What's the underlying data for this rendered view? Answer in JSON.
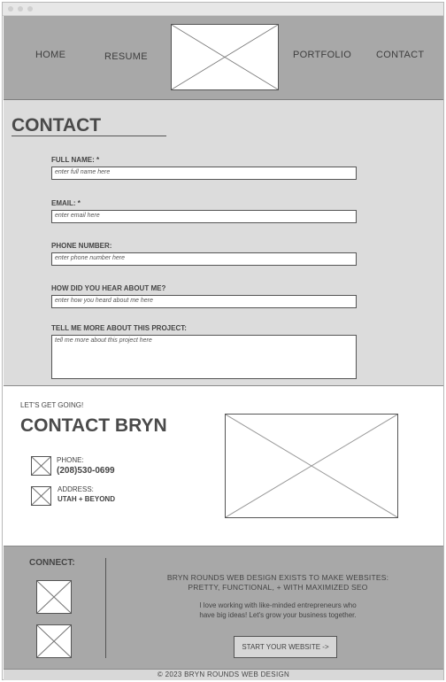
{
  "nav": {
    "home": "HOME",
    "resume": "RESUME",
    "portfolio": "PORTFOLIO",
    "contact": "CONTACT"
  },
  "contact_form": {
    "title": "CONTACT",
    "fields": [
      {
        "label": "FULL NAME: *",
        "placeholder": "enter full name here"
      },
      {
        "label": "EMAIL: *",
        "placeholder": "enter email here"
      },
      {
        "label": "PHONE NUMBER:",
        "placeholder": "enter phone number here"
      },
      {
        "label": "HOW DID YOU HEAR ABOUT ME?",
        "placeholder": "enter how you heard about me here"
      },
      {
        "label": "TELL ME MORE ABOUT THIS PROJECT:",
        "placeholder": "tell me more about this project here"
      }
    ]
  },
  "info": {
    "eyebrow": "LET'S GET GOING!",
    "title": "CONTACT BRYN",
    "phone_label": "PHONE:",
    "phone_value": "(208)530-0699",
    "address_label": "ADDRESS:",
    "address_value": "UTAH + BEYOND"
  },
  "footer": {
    "connect": "CONNECT:",
    "tagline_1": "BRYN ROUNDS WEB DESIGN EXISTS TO MAKE WEBSITES:",
    "tagline_2": "PRETTY, FUNCTIONAL, + WITH MAXIMIZED SEO",
    "blurb_1": "I love working with like-minded entrepreneurs who",
    "blurb_2": "have big ideas! Let's grow your business together.",
    "cta": "START YOUR WEBSITE ->",
    "copyright": "© 2023 BRYN ROUNDS WEB DESIGN"
  }
}
